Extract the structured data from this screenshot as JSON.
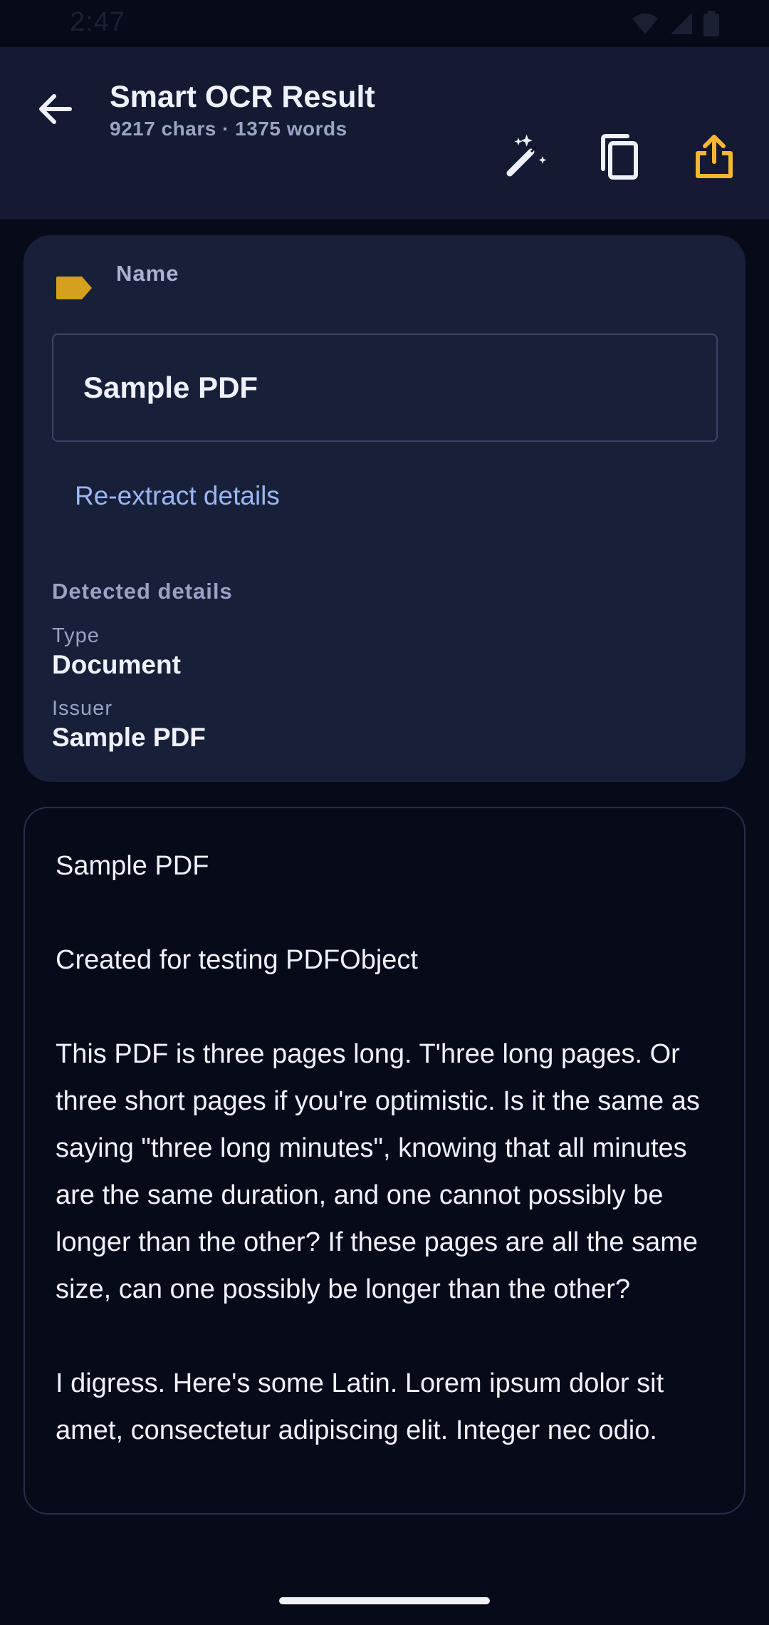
{
  "status_bar": {
    "time": "2:47",
    "icons": [
      "wifi-icon",
      "signal-icon",
      "battery-icon"
    ]
  },
  "app_bar": {
    "title": "Smart OCR Result",
    "subtitle": "9217 chars · 1375 words",
    "actions": [
      "magic-wand-icon",
      "copy-icon",
      "share-icon"
    ],
    "accent_color": "#f5b731"
  },
  "details_card": {
    "name_label": "Name",
    "name_value": "Sample PDF",
    "reextract_label": "Re-extract details",
    "detected_heading": "Detected details",
    "fields": [
      {
        "label": "Type",
        "value": "Document"
      },
      {
        "label": "Issuer",
        "value": "Sample PDF"
      }
    ]
  },
  "ocr_text": {
    "paragraphs": [
      "Sample PDF",
      "Created for testing PDFObject",
      "This PDF is three pages long. T'hree long pages. Or three short pages if you're optimistic. Is it the same as saying \"three long minutes\", knowing that all minutes are the same duration, and one cannot possibly be longer than the other? If these pages are all the same size, can one possibly be longer than the other?",
      "I digress. Here's some Latin. Lorem ipsum dolor sit amet, consectetur adipiscing elit. Integer nec odio."
    ]
  }
}
